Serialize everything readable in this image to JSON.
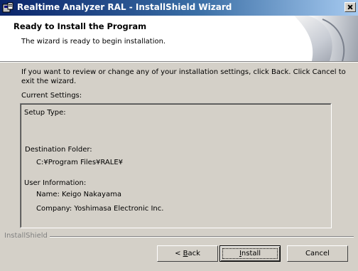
{
  "window": {
    "title": "Realtime Analyzer RAL - InstallShield Wizard",
    "app_icon": "installer-icon",
    "close_icon": "close-icon"
  },
  "header": {
    "title": "Ready to Install the Program",
    "subtitle": "The wizard is ready to begin installation."
  },
  "body": {
    "intro": "If you want to review or change any of your installation settings, click Back. Click Cancel to exit the wizard.",
    "current_settings_label": "Current Settings:"
  },
  "settings": {
    "setup_type_label": "Setup Type:",
    "destination_label": "Destination Folder:",
    "destination_value": "C:¥Program Files¥RALE¥",
    "user_info_label": "User Information:",
    "name": "Name: Keigo Nakayama",
    "company": "Company: Yoshimasa Electronic Inc."
  },
  "footer": {
    "brand": "InstallShield",
    "back_prefix": "< ",
    "back_mnemonic": "B",
    "back_rest": "ack",
    "install_mnemonic": "I",
    "install_rest": "nstall",
    "cancel_label": "Cancel"
  },
  "colors": {
    "titlebar_start": "#0a246a",
    "titlebar_end": "#a6caf0",
    "face": "#d4d0c8"
  }
}
